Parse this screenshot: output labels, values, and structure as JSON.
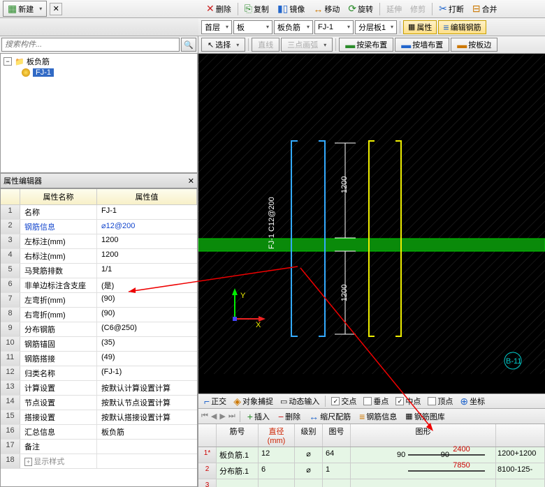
{
  "top_toolbar": {
    "delete": "删除",
    "copy": "复制",
    "mirror": "镜像",
    "move": "移动",
    "rotate": "旋转",
    "extend": "延伸",
    "trim": "修剪",
    "break": "打断",
    "merge": "合并"
  },
  "new_btn": "新建",
  "search": {
    "placeholder": "搜索构件..."
  },
  "tree": {
    "root": "板负筋",
    "child": "FJ-1"
  },
  "dropdowns": {
    "floor": "首层",
    "category": "板",
    "subcat": "板负筋",
    "item": "FJ-1",
    "layer": "分层板1",
    "attr_btn": "属性",
    "edit_btn": "编辑钢筋"
  },
  "select_row": {
    "select": "选择",
    "line": "直线",
    "arc": "三点画弧",
    "by_wall": "按梁布置",
    "by_wall2": "按墙布置",
    "by_board": "按板边"
  },
  "canvas": {
    "callout": "FJ-1  C12@200",
    "dim_top": "1200",
    "dim_bot": "1200",
    "grid": "B-11"
  },
  "prop": {
    "title": "属性编辑器",
    "head_name": "属性名称",
    "head_val": "属性值",
    "rows": [
      {
        "n": "1",
        "name": "名称",
        "val": "FJ-1"
      },
      {
        "n": "2",
        "name": "钢筋信息",
        "val": "⌀12@200",
        "hl": true
      },
      {
        "n": "3",
        "name": "左标注(mm)",
        "val": "1200"
      },
      {
        "n": "4",
        "name": "右标注(mm)",
        "val": "1200"
      },
      {
        "n": "5",
        "name": "马凳筋排数",
        "val": "1/1"
      },
      {
        "n": "6",
        "name": "非单边标注含支座",
        "val": "(是)"
      },
      {
        "n": "7",
        "name": "左弯折(mm)",
        "val": "(90)"
      },
      {
        "n": "8",
        "name": "右弯折(mm)",
        "val": "(90)"
      },
      {
        "n": "9",
        "name": "分布钢筋",
        "val": "(C6@250)"
      },
      {
        "n": "10",
        "name": "钢筋锚固",
        "val": "(35)"
      },
      {
        "n": "11",
        "name": "钢筋搭接",
        "val": "(49)"
      },
      {
        "n": "12",
        "name": "归类名称",
        "val": "(FJ-1)"
      },
      {
        "n": "13",
        "name": "计算设置",
        "val": "按默认计算设置计算"
      },
      {
        "n": "14",
        "name": "节点设置",
        "val": "按默认节点设置计算"
      },
      {
        "n": "15",
        "name": "搭接设置",
        "val": "按默认搭接设置计算"
      },
      {
        "n": "16",
        "name": "汇总信息",
        "val": "板负筋"
      },
      {
        "n": "17",
        "name": "备注",
        "val": ""
      },
      {
        "n": "18",
        "name": "显示样式",
        "val": "",
        "dim": true,
        "exp": true
      }
    ]
  },
  "bottom_tb": {
    "ortho": "正交",
    "osnap": "对象捕捉",
    "dyn": "动态输入",
    "cross": "交点",
    "perp": "垂点",
    "mid": "中点",
    "top": "顶点",
    "coord": "坐标"
  },
  "result_tb": {
    "insert": "插入",
    "delete": "删除",
    "scale": "缩尺配筋",
    "info": "钢筋信息",
    "lib": "钢筋图库"
  },
  "result_table": {
    "head": {
      "no": "",
      "code": "筋号",
      "dia": "直径(mm)",
      "lvl": "级别",
      "fig": "图号",
      "shape": "图形",
      "calc": ""
    },
    "rows": [
      {
        "no": "1*",
        "code": "板负筋.1",
        "dia": "12",
        "lvl": "⌀",
        "fig": "64",
        "left": "90",
        "len": "2400",
        "right": "90",
        "calc": "1200+1200"
      },
      {
        "no": "2",
        "code": "分布筋.1",
        "dia": "6",
        "lvl": "⌀",
        "fig": "1",
        "left": "",
        "len": "7850",
        "right": "",
        "calc": "8100-125-"
      },
      {
        "no": "3",
        "code": "",
        "dia": "",
        "lvl": "",
        "fig": "",
        "left": "",
        "len": "",
        "right": "",
        "calc": ""
      }
    ]
  }
}
